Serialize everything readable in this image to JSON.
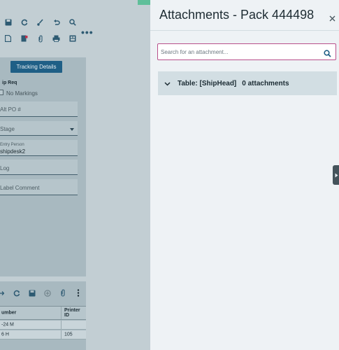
{
  "colors": {
    "accent": "#1f5f86",
    "search_focus_border": "#b84f8b",
    "drawer_bg": "#eef2f5",
    "accordion_bg": "#d2dee3"
  },
  "background_app": {
    "toolbar_icons_row1": [
      "save-icon",
      "refresh-icon",
      "clear-brush-icon",
      "undo-icon",
      "search-icon"
    ],
    "toolbar_icons_row2": [
      "new-document-icon",
      "flag-document-icon",
      "attachment-icon",
      "print-icon",
      "layout-icon"
    ],
    "tracking_button_label": "Tracking Details",
    "req_label": "ip Req",
    "no_markings_label": "No Markings",
    "alt_po_placeholder": "Alt PO #",
    "stage_placeholder": "Stage",
    "entry_person_caption": "Entry Person",
    "entry_person_value": "shipdesk2",
    "log_placeholder": "Log",
    "label_comment_placeholder": "Label Comment",
    "grid": {
      "columns": [
        "umber",
        "Printer ID"
      ],
      "rows": [
        [
          "-24 M",
          ""
        ],
        [
          "6 H",
          "105"
        ]
      ]
    }
  },
  "drawer": {
    "title": "Attachments - Pack 444498",
    "search_placeholder": "Search for an attachment...",
    "accordion": {
      "title": "Table: [ShipHead]",
      "count_label": "0 attachments"
    }
  }
}
